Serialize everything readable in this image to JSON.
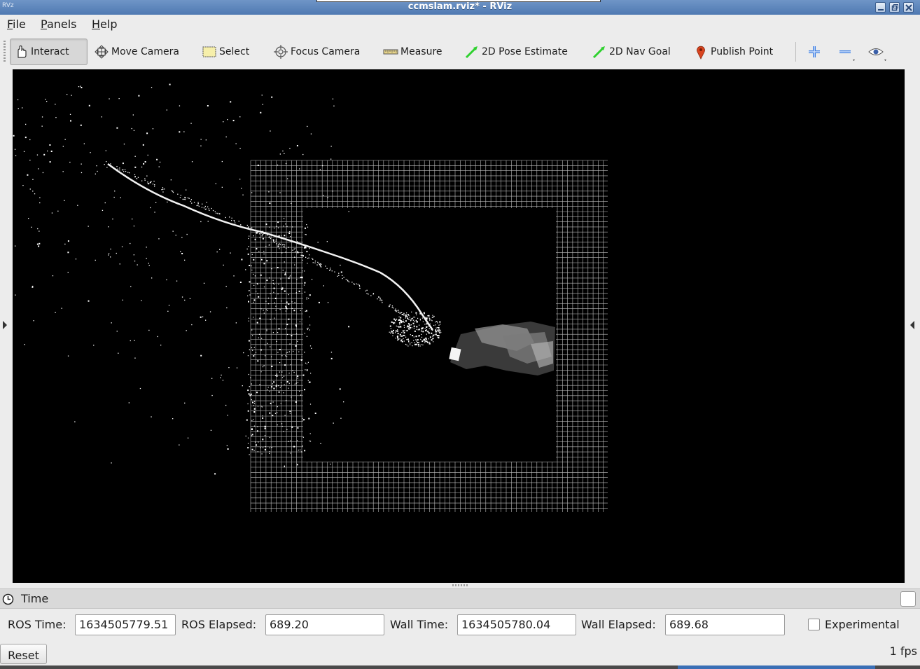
{
  "window": {
    "app_icon_text": "RVz",
    "title": "ccmslam.rviz* - RViz"
  },
  "menu": {
    "items": [
      {
        "underline": "F",
        "rest": "ile"
      },
      {
        "underline": "P",
        "rest": "anels"
      },
      {
        "underline": "H",
        "rest": "elp"
      }
    ]
  },
  "toolbar": {
    "tools": [
      {
        "label": "Interact",
        "icon": "hand-pointer-icon",
        "active": true
      },
      {
        "label": "Move Camera",
        "icon": "move-arrows-icon",
        "active": false
      },
      {
        "label": "Select",
        "icon": "select-rect-icon",
        "active": false
      },
      {
        "label": "Focus Camera",
        "icon": "focus-target-icon",
        "active": false
      },
      {
        "label": "Measure",
        "icon": "ruler-icon",
        "active": false
      },
      {
        "label": "2D Pose Estimate",
        "icon": "green-arrow-icon",
        "active": false
      },
      {
        "label": "2D Nav Goal",
        "icon": "green-arrow-icon",
        "active": false
      },
      {
        "label": "Publish Point",
        "icon": "map-pin-icon",
        "active": false
      }
    ],
    "extra_buttons": [
      "add-tool-icon",
      "remove-tool-icon",
      "eye-view-icon"
    ],
    "accent_green": "#2fd12f",
    "accent_red": "#d9441f",
    "accent_blue": "#3c7de0"
  },
  "viewport": {
    "background": "#000000"
  },
  "time_panel": {
    "title": "Time",
    "ros_time_label": "ROS Time:",
    "ros_time_value": "1634505779.51",
    "ros_elapsed_label": "ROS Elapsed:",
    "ros_elapsed_value": "689.20",
    "wall_time_label": "Wall Time:",
    "wall_time_value": "1634505780.04",
    "wall_elapsed_label": "Wall Elapsed:",
    "wall_elapsed_value": "689.68",
    "experimental_label": "Experimental",
    "experimental_checked": false,
    "reset_label": "Reset",
    "fps": "1 fps"
  }
}
